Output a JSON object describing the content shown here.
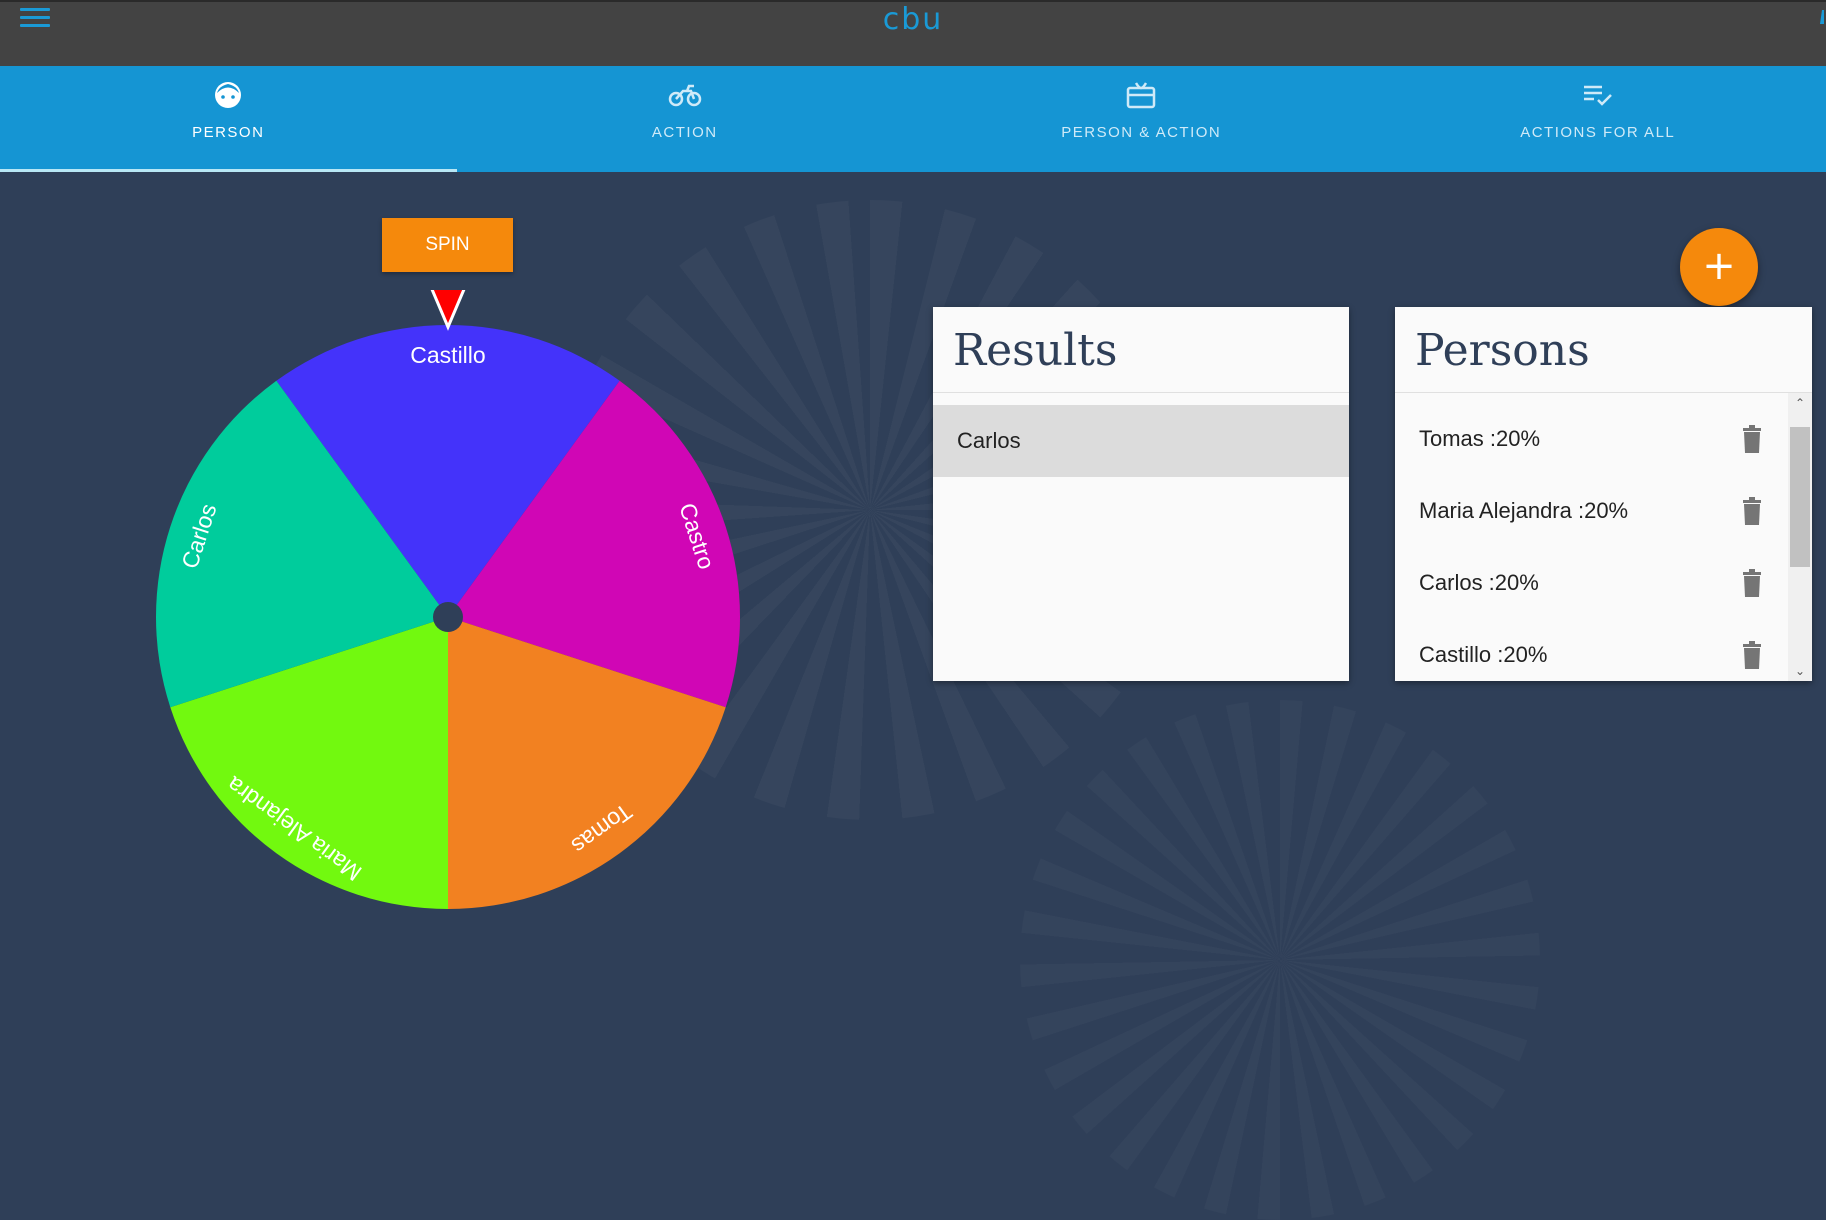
{
  "app": {
    "title": "cbu"
  },
  "tabs": [
    {
      "label": "PERSON",
      "icon": "face-icon",
      "active": true
    },
    {
      "label": "ACTION",
      "icon": "motorcycle-icon",
      "active": false
    },
    {
      "label": "PERSON & ACTION",
      "icon": "gift-card-icon",
      "active": false
    },
    {
      "label": "ACTIONS FOR ALL",
      "icon": "playlist-check-icon",
      "active": false
    }
  ],
  "spin_button": {
    "label": "SPIN"
  },
  "wheel": {
    "segments": [
      {
        "label": "Castillo",
        "color": "#4433fa"
      },
      {
        "label": "Castro",
        "color": "#d006b5"
      },
      {
        "label": "Tomas",
        "color": "#f28121"
      },
      {
        "label": "Maria Alejandra",
        "color": "#72f90f"
      },
      {
        "label": "Carlos",
        "color": "#00cc9c"
      }
    ],
    "pointer_color": "#ff0000",
    "hub_color": "#2f3f58"
  },
  "add_button": {
    "label": "+"
  },
  "results": {
    "title": "Results",
    "items": [
      "Carlos"
    ]
  },
  "persons": {
    "title": "Persons",
    "items": [
      {
        "label": "Tomas :20%"
      },
      {
        "label": "Maria Alejandra :20%"
      },
      {
        "label": "Carlos :20%"
      },
      {
        "label": "Castillo :20%"
      }
    ]
  },
  "colors": {
    "accent": "#1595d3",
    "orange": "#f5890c",
    "topbar": "#434343",
    "background": "#2f3f58"
  }
}
